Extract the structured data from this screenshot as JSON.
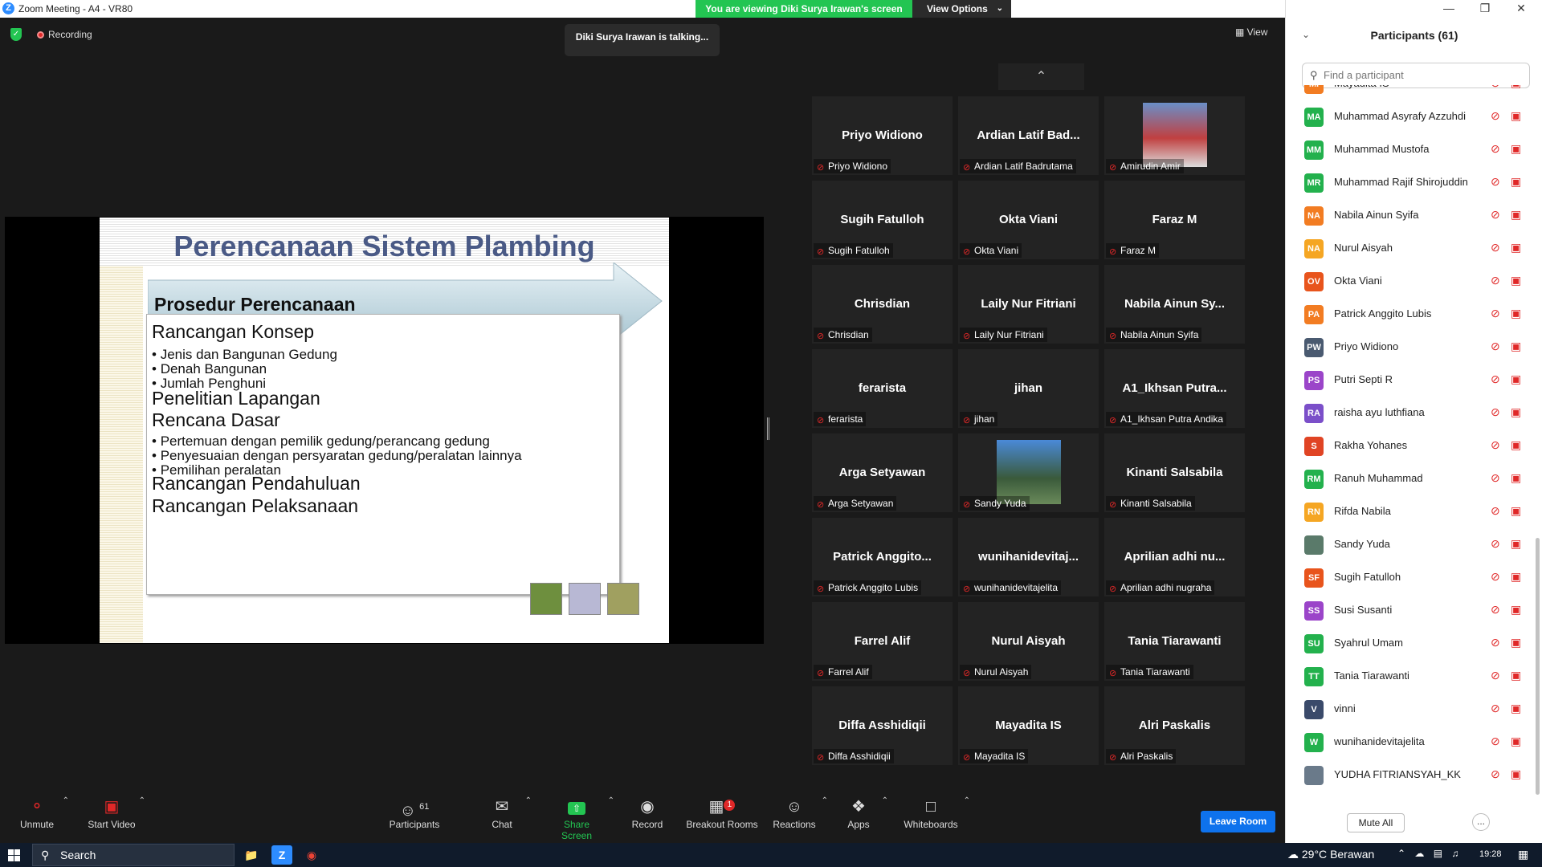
{
  "window": {
    "title": "Zoom Meeting - A4 - VR80",
    "logo_letter": "Z"
  },
  "banner": {
    "viewing_text": "You are viewing Diki Surya Irawan's screen",
    "view_options": "View Options"
  },
  "status": {
    "recording": "Recording",
    "talking": "Diki Surya Irawan is talking...",
    "view": "View"
  },
  "slide": {
    "title": "Perencanaan Sistem Plambing",
    "arrow_heading": "Prosedur Perencanaan",
    "lines": [
      {
        "kind": "h",
        "text": "Rancangan Konsep"
      },
      {
        "kind": "b",
        "text": "Jenis dan Bangunan Gedung"
      },
      {
        "kind": "b",
        "text": "Denah Bangunan"
      },
      {
        "kind": "b",
        "text": "Jumlah Penghuni"
      },
      {
        "kind": "h",
        "text": "Penelitian Lapangan"
      },
      {
        "kind": "h",
        "text": "Rencana Dasar"
      },
      {
        "kind": "b",
        "text": "Pertemuan dengan pemilik gedung/perancang gedung"
      },
      {
        "kind": "b",
        "text": "Penyesuaian dengan persyaratan gedung/peralatan lainnya"
      },
      {
        "kind": "b",
        "text": "Pemilihan peralatan"
      },
      {
        "kind": "h",
        "text": "Rancangan Pendahuluan"
      },
      {
        "kind": "h",
        "text": "Rancangan Pelaksanaan"
      }
    ]
  },
  "gallery": {
    "tiles": [
      {
        "name": "Priyo Widiono",
        "label": "Priyo Widiono",
        "photo": false
      },
      {
        "name": "Ardian Latif Bad...",
        "label": "Ardian Latif Badrutama",
        "photo": false
      },
      {
        "name": "",
        "label": "Amirudin Amir",
        "photo": true
      },
      {
        "name": "Sugih Fatulloh",
        "label": "Sugih Fatulloh",
        "photo": false
      },
      {
        "name": "Okta Viani",
        "label": "Okta Viani",
        "photo": false
      },
      {
        "name": "Faraz M",
        "label": "Faraz M",
        "photo": false
      },
      {
        "name": "Chrisdian",
        "label": "Chrisdian",
        "photo": false
      },
      {
        "name": "Laily Nur Fitriani",
        "label": "Laily Nur Fitriani",
        "photo": false
      },
      {
        "name": "Nabila Ainun Sy...",
        "label": "Nabila Ainun Syifa",
        "photo": false
      },
      {
        "name": "ferarista",
        "label": "ferarista",
        "photo": false
      },
      {
        "name": "jihan",
        "label": "jihan",
        "photo": false
      },
      {
        "name": "A1_Ikhsan Putra...",
        "label": "A1_Ikhsan Putra Andika",
        "photo": false
      },
      {
        "name": "Arga Setyawan",
        "label": "Arga Setyawan",
        "photo": false
      },
      {
        "name": "",
        "label": "Sandy Yuda",
        "photo": true
      },
      {
        "name": "Kinanti Salsabila",
        "label": "Kinanti Salsabila",
        "photo": false
      },
      {
        "name": "Patrick Anggito...",
        "label": "Patrick Anggito Lubis",
        "photo": false
      },
      {
        "name": "wunihanidevitaj...",
        "label": "wunihanidevitajelita",
        "photo": false
      },
      {
        "name": "Aprilian adhi nu...",
        "label": "Aprilian adhi nugraha",
        "photo": false
      },
      {
        "name": "Farrel Alif",
        "label": "Farrel Alif",
        "photo": false
      },
      {
        "name": "Nurul Aisyah",
        "label": "Nurul Aisyah",
        "photo": false
      },
      {
        "name": "Tania Tiarawanti",
        "label": "Tania Tiarawanti",
        "photo": false
      },
      {
        "name": "Diffa Asshidiqii",
        "label": "Diffa Asshidiqii",
        "photo": false
      },
      {
        "name": "Mayadita IS",
        "label": "Mayadita IS",
        "photo": false
      },
      {
        "name": "Alri Paskalis",
        "label": "Alri Paskalis",
        "photo": false
      }
    ]
  },
  "toolbar": {
    "unmute": "Unmute",
    "start_video": "Start Video",
    "participants": "Participants",
    "participants_count": "61",
    "chat": "Chat",
    "share_screen": "Share Screen",
    "record": "Record",
    "breakout_rooms": "Breakout Rooms",
    "breakout_badge": "1",
    "reactions": "Reactions",
    "apps": "Apps",
    "whiteboards": "Whiteboards",
    "leave_room": "Leave Room"
  },
  "panel": {
    "title": "Participants (61)",
    "search_placeholder": "Find a participant",
    "mute_all": "Mute All",
    "more": "...",
    "participants": [
      {
        "initials": "MI",
        "name": "Mayadita IS",
        "color": "#f27c22"
      },
      {
        "initials": "MA",
        "name": "Muhammad Asyrafy Azzuhdi",
        "color": "#23b14d"
      },
      {
        "initials": "MM",
        "name": "Muhammad Mustofa",
        "color": "#23b14d"
      },
      {
        "initials": "MR",
        "name": "Muhammad Rajif Shirojuddin",
        "color": "#23b14d"
      },
      {
        "initials": "NA",
        "name": "Nabila Ainun Syifa",
        "color": "#f27c22"
      },
      {
        "initials": "NA",
        "name": "Nurul Aisyah",
        "color": "#f5a623"
      },
      {
        "initials": "OV",
        "name": "Okta Viani",
        "color": "#e8541c"
      },
      {
        "initials": "PA",
        "name": "Patrick Anggito Lubis",
        "color": "#f27c22"
      },
      {
        "initials": "PW",
        "name": "Priyo Widiono",
        "color": "#4a5a70"
      },
      {
        "initials": "PS",
        "name": "Putri Septi R",
        "color": "#9b45c9"
      },
      {
        "initials": "RA",
        "name": "raisha ayu luthfiana",
        "color": "#7b4fc9"
      },
      {
        "initials": "S",
        "name": "Rakha Yohanes",
        "color": "#e04424"
      },
      {
        "initials": "RM",
        "name": "Ranuh Muhammad",
        "color": "#23b14d"
      },
      {
        "initials": "RN",
        "name": "Rifda Nabila",
        "color": "#f5a623"
      },
      {
        "initials": "",
        "name": "Sandy Yuda",
        "color": "#5a7a6a"
      },
      {
        "initials": "SF",
        "name": "Sugih Fatulloh",
        "color": "#e8541c"
      },
      {
        "initials": "SS",
        "name": "Susi Susanti",
        "color": "#9b45c9"
      },
      {
        "initials": "SU",
        "name": "Syahrul Umam",
        "color": "#23b14d"
      },
      {
        "initials": "TT",
        "name": "Tania Tiarawanti",
        "color": "#23b14d"
      },
      {
        "initials": "V",
        "name": "vinni",
        "color": "#3a4a6a"
      },
      {
        "initials": "W",
        "name": "wunihanidevitajelita",
        "color": "#23b14d"
      },
      {
        "initials": "",
        "name": "YUDHA FITRIANSYAH_KK",
        "color": "#6a7a8a"
      }
    ]
  },
  "taskbar": {
    "search": "Search",
    "weather_temp": "29°C",
    "weather_text": "Berawan",
    "time": "19:28"
  }
}
